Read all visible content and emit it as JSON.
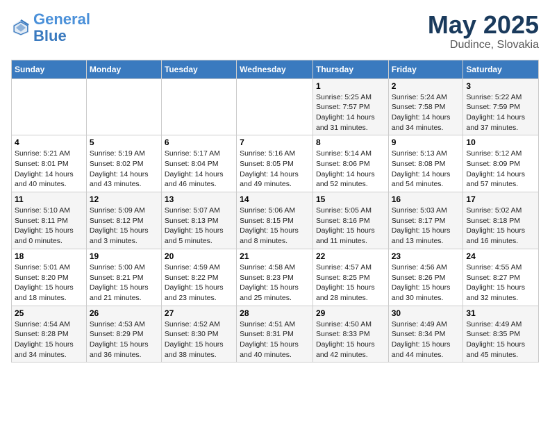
{
  "header": {
    "logo_line1": "General",
    "logo_line2": "Blue",
    "title": "May 2025",
    "location": "Dudince, Slovakia"
  },
  "weekdays": [
    "Sunday",
    "Monday",
    "Tuesday",
    "Wednesday",
    "Thursday",
    "Friday",
    "Saturday"
  ],
  "weeks": [
    [
      {
        "day": "",
        "info": ""
      },
      {
        "day": "",
        "info": ""
      },
      {
        "day": "",
        "info": ""
      },
      {
        "day": "",
        "info": ""
      },
      {
        "day": "1",
        "info": "Sunrise: 5:25 AM\nSunset: 7:57 PM\nDaylight: 14 hours\nand 31 minutes."
      },
      {
        "day": "2",
        "info": "Sunrise: 5:24 AM\nSunset: 7:58 PM\nDaylight: 14 hours\nand 34 minutes."
      },
      {
        "day": "3",
        "info": "Sunrise: 5:22 AM\nSunset: 7:59 PM\nDaylight: 14 hours\nand 37 minutes."
      }
    ],
    [
      {
        "day": "4",
        "info": "Sunrise: 5:21 AM\nSunset: 8:01 PM\nDaylight: 14 hours\nand 40 minutes."
      },
      {
        "day": "5",
        "info": "Sunrise: 5:19 AM\nSunset: 8:02 PM\nDaylight: 14 hours\nand 43 minutes."
      },
      {
        "day": "6",
        "info": "Sunrise: 5:17 AM\nSunset: 8:04 PM\nDaylight: 14 hours\nand 46 minutes."
      },
      {
        "day": "7",
        "info": "Sunrise: 5:16 AM\nSunset: 8:05 PM\nDaylight: 14 hours\nand 49 minutes."
      },
      {
        "day": "8",
        "info": "Sunrise: 5:14 AM\nSunset: 8:06 PM\nDaylight: 14 hours\nand 52 minutes."
      },
      {
        "day": "9",
        "info": "Sunrise: 5:13 AM\nSunset: 8:08 PM\nDaylight: 14 hours\nand 54 minutes."
      },
      {
        "day": "10",
        "info": "Sunrise: 5:12 AM\nSunset: 8:09 PM\nDaylight: 14 hours\nand 57 minutes."
      }
    ],
    [
      {
        "day": "11",
        "info": "Sunrise: 5:10 AM\nSunset: 8:11 PM\nDaylight: 15 hours\nand 0 minutes."
      },
      {
        "day": "12",
        "info": "Sunrise: 5:09 AM\nSunset: 8:12 PM\nDaylight: 15 hours\nand 3 minutes."
      },
      {
        "day": "13",
        "info": "Sunrise: 5:07 AM\nSunset: 8:13 PM\nDaylight: 15 hours\nand 5 minutes."
      },
      {
        "day": "14",
        "info": "Sunrise: 5:06 AM\nSunset: 8:15 PM\nDaylight: 15 hours\nand 8 minutes."
      },
      {
        "day": "15",
        "info": "Sunrise: 5:05 AM\nSunset: 8:16 PM\nDaylight: 15 hours\nand 11 minutes."
      },
      {
        "day": "16",
        "info": "Sunrise: 5:03 AM\nSunset: 8:17 PM\nDaylight: 15 hours\nand 13 minutes."
      },
      {
        "day": "17",
        "info": "Sunrise: 5:02 AM\nSunset: 8:18 PM\nDaylight: 15 hours\nand 16 minutes."
      }
    ],
    [
      {
        "day": "18",
        "info": "Sunrise: 5:01 AM\nSunset: 8:20 PM\nDaylight: 15 hours\nand 18 minutes."
      },
      {
        "day": "19",
        "info": "Sunrise: 5:00 AM\nSunset: 8:21 PM\nDaylight: 15 hours\nand 21 minutes."
      },
      {
        "day": "20",
        "info": "Sunrise: 4:59 AM\nSunset: 8:22 PM\nDaylight: 15 hours\nand 23 minutes."
      },
      {
        "day": "21",
        "info": "Sunrise: 4:58 AM\nSunset: 8:23 PM\nDaylight: 15 hours\nand 25 minutes."
      },
      {
        "day": "22",
        "info": "Sunrise: 4:57 AM\nSunset: 8:25 PM\nDaylight: 15 hours\nand 28 minutes."
      },
      {
        "day": "23",
        "info": "Sunrise: 4:56 AM\nSunset: 8:26 PM\nDaylight: 15 hours\nand 30 minutes."
      },
      {
        "day": "24",
        "info": "Sunrise: 4:55 AM\nSunset: 8:27 PM\nDaylight: 15 hours\nand 32 minutes."
      }
    ],
    [
      {
        "day": "25",
        "info": "Sunrise: 4:54 AM\nSunset: 8:28 PM\nDaylight: 15 hours\nand 34 minutes."
      },
      {
        "day": "26",
        "info": "Sunrise: 4:53 AM\nSunset: 8:29 PM\nDaylight: 15 hours\nand 36 minutes."
      },
      {
        "day": "27",
        "info": "Sunrise: 4:52 AM\nSunset: 8:30 PM\nDaylight: 15 hours\nand 38 minutes."
      },
      {
        "day": "28",
        "info": "Sunrise: 4:51 AM\nSunset: 8:31 PM\nDaylight: 15 hours\nand 40 minutes."
      },
      {
        "day": "29",
        "info": "Sunrise: 4:50 AM\nSunset: 8:33 PM\nDaylight: 15 hours\nand 42 minutes."
      },
      {
        "day": "30",
        "info": "Sunrise: 4:49 AM\nSunset: 8:34 PM\nDaylight: 15 hours\nand 44 minutes."
      },
      {
        "day": "31",
        "info": "Sunrise: 4:49 AM\nSunset: 8:35 PM\nDaylight: 15 hours\nand 45 minutes."
      }
    ]
  ]
}
